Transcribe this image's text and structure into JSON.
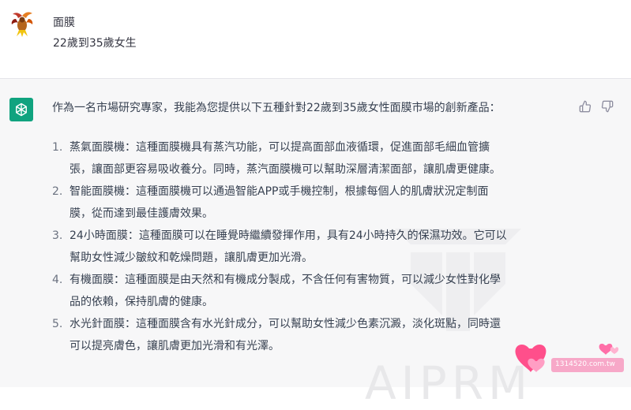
{
  "user": {
    "avatar": "phoenix-avatar-icon",
    "line1": "面膜",
    "line2": "22歲到35歲女生"
  },
  "assistant": {
    "avatar": "openai-logo-icon",
    "intro": "作為一名市場研究專家，我能為您提供以下五種針對22歲到35歲女性面膜市場的創新產品：",
    "items": [
      {
        "num": "1.",
        "title": "蒸氣面膜機",
        "text": "：這種面膜機具有蒸汽功能，可以提高面部血液循環，促進面部毛細血管擴",
        "text2": "張，讓面部更容易吸收養分。同時，蒸汽面膜機可以幫助深層清潔面部，讓肌膚更健康。"
      },
      {
        "num": "2.",
        "title": "智能面膜機",
        "text": "：這種面膜機可以通過智能APP或手機控制，根據每個人的肌膚狀況定制面",
        "text2": "膜，從而達到最佳護膚效果。"
      },
      {
        "num": "3.",
        "title": "24小時面膜",
        "text": "：這種面膜可以在睡覺時繼續發揮作用，具有24小時持久的保濕功效。它可以",
        "text2": "幫助女性減少皺紋和乾燥問題，讓肌膚更加光滑。"
      },
      {
        "num": "4.",
        "title": "有機面膜",
        "text": "：這種面膜是由天然和有機成分製成，不含任何有害物質，可以減少女性對化學",
        "text2": "品的依賴，保持肌膚的健康。"
      },
      {
        "num": "5.",
        "title": "水光針面膜",
        "text": "：這種面膜含有水光針成分，可以幫助女性減少色素沉澱，淡化斑點，同時還",
        "text2": "可以提亮膚色，讓肌膚更加光滑和有光澤。"
      }
    ]
  },
  "watermark": {
    "text": "AIPRM"
  },
  "site_badge": {
    "text": "1314520.com.tw"
  },
  "icons": {
    "thumb_up": "thumbs-up-icon",
    "thumb_down": "thumbs-down-icon"
  },
  "colors": {
    "ai_avatar": "#10a37f",
    "assistant_bg": "#f7f7f8",
    "badge_pink": "#ff6fa8"
  }
}
